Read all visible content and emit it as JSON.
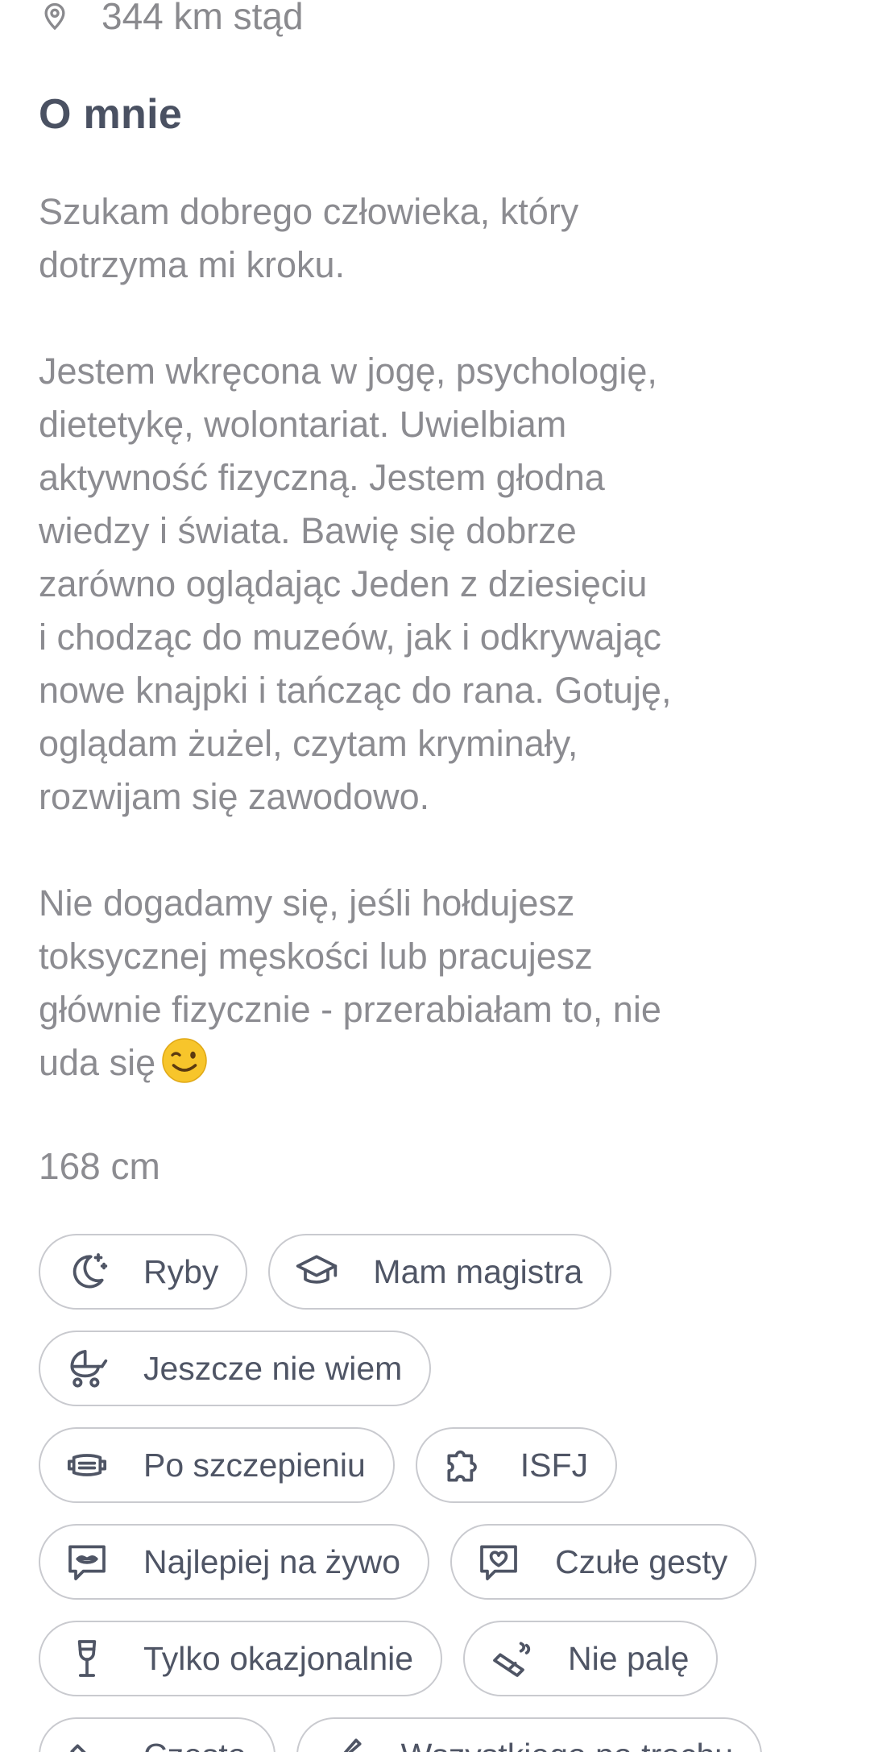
{
  "location": {
    "icon": "location-pin-icon",
    "distance_text": "344 km stąd"
  },
  "about": {
    "title": "O mnie",
    "paragraphs": [
      "Szukam dobrego człowieka, który\ndotrzyma mi kroku.",
      "Jestem wkręcona w jogę, psychologię,\ndietetykę, wolontariat. Uwielbiam\naktywność fizyczną. Jestem głodna\nwiedzy i świata. Bawię się dobrze\nzarówno oglądając Jeden z dziesięciu\ni chodząc do muzeów, jak i odkrywając\nnowe knajpki i tańcząc do rana. Gotuję,\noglądam żużel, czytam kryminały,\nrozwijam się zawodowo.",
      "Nie dogadamy się, jeśli hołdujesz\ntoksycznej męskości lub pracujesz\ngłównie fizycznie - przerabiałam to, nie\nuda się"
    ],
    "emoji": "winking-face-emoji"
  },
  "height": "168 cm",
  "chips": [
    {
      "label": "Ryby",
      "icon": "moon-stars-icon"
    },
    {
      "label": "Mam magistra",
      "icon": "graduation-cap-icon"
    },
    {
      "label": "Jeszcze nie wiem",
      "icon": "baby-stroller-icon"
    },
    {
      "label": "Po szczepieniu",
      "icon": "face-mask-icon"
    },
    {
      "label": "ISFJ",
      "icon": "puzzle-icon"
    },
    {
      "label": "Najlepiej na żywo",
      "icon": "chat-bubble-lips-icon"
    },
    {
      "label": "Czułe gesty",
      "icon": "chat-bubble-heart-icon"
    },
    {
      "label": "Tylko okazjonalnie",
      "icon": "wine-glass-icon"
    },
    {
      "label": "Nie palę",
      "icon": "cigarette-icon"
    },
    {
      "label": "Często",
      "icon": "dumbbell-icon"
    },
    {
      "label": "Wszystkiego po trochu",
      "icon": "food-slice-icon"
    }
  ],
  "colors": {
    "text_muted": "#8c8c91",
    "title": "#4a5162",
    "chip_text": "#4f5565",
    "chip_border": "#c9cacf",
    "emoji_face": "#f7c52b"
  }
}
